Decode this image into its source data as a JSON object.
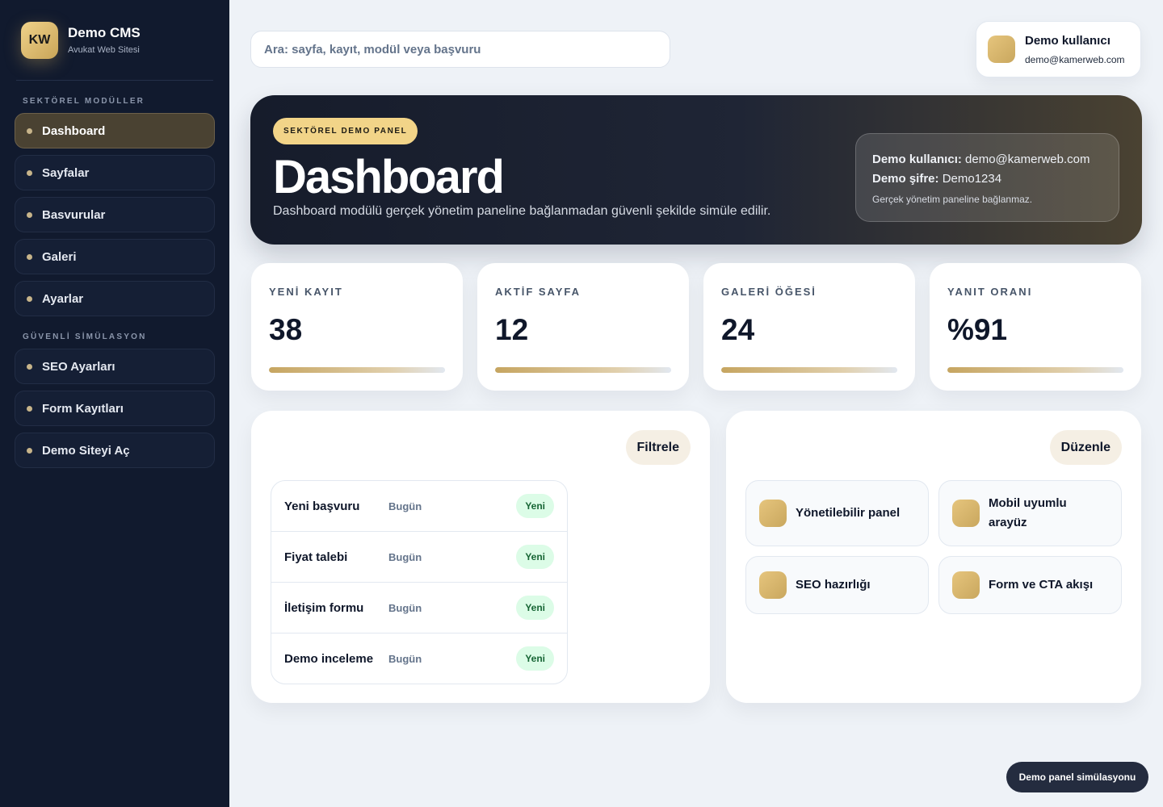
{
  "brand": {
    "logo": "KW",
    "name": "Demo CMS",
    "subtitle": "Avukat Web Sitesi"
  },
  "sidebar": {
    "section1_title": "SEKTÖREL MODÜLLER",
    "section1_items": [
      {
        "label": "Dashboard",
        "active": true
      },
      {
        "label": "Sayfalar"
      },
      {
        "label": "Basvurular"
      },
      {
        "label": "Galeri"
      },
      {
        "label": "Ayarlar"
      }
    ],
    "section2_title": "GÜVENLİ SİMÜLASYON",
    "section2_items": [
      {
        "label": "SEO Ayarları"
      },
      {
        "label": "Form Kayıtları"
      },
      {
        "label": "Demo Siteyi Aç"
      }
    ]
  },
  "search": {
    "placeholder": "Ara: sayfa, kayıt, modül veya başvuru"
  },
  "user": {
    "name": "Demo kullanıcı",
    "email": "demo@kamerweb.com"
  },
  "hero": {
    "badge": "SEKTÖREL DEMO PANEL",
    "title": "Dashboard",
    "description": "Dashboard modülü gerçek yönetim paneline bağlanmadan güvenli şekilde simüle edilir.",
    "cred_user_label": "Demo kullanıcı:",
    "cred_user_value": "demo@kamerweb.com",
    "cred_pass_label": "Demo şifre:",
    "cred_pass_value": "Demo1234",
    "cred_note": "Gerçek yönetim paneline bağlanmaz."
  },
  "stats": [
    {
      "label": "YENİ KAYIT",
      "value": "38"
    },
    {
      "label": "AKTİF SAYFA",
      "value": "12"
    },
    {
      "label": "GALERİ ÖĞESİ",
      "value": "24"
    },
    {
      "label": "YANIT ORANI",
      "value": "%91"
    }
  ],
  "records_panel": {
    "button": "Filtrele",
    "rows": [
      {
        "title": "Yeni başvuru",
        "date": "Bugün",
        "status": "Yeni"
      },
      {
        "title": "Fiyat talebi",
        "date": "Bugün",
        "status": "Yeni"
      },
      {
        "title": "İletişim formu",
        "date": "Bugün",
        "status": "Yeni"
      },
      {
        "title": "Demo inceleme",
        "date": "Bugün",
        "status": "Yeni"
      }
    ]
  },
  "features_panel": {
    "button": "Düzenle",
    "items": [
      {
        "label": "Yönetilebilir panel"
      },
      {
        "label": "Mobil uyumlu arayüz"
      },
      {
        "label": "SEO hazırlığı"
      },
      {
        "label": "Form ve CTA akışı"
      }
    ]
  },
  "footer": {
    "label": "Demo panel simülasyonu"
  },
  "colors": {
    "sidebar_bg": "#111a2e",
    "accent_gold": "#f2d488",
    "status_green": "#dcfce7"
  }
}
